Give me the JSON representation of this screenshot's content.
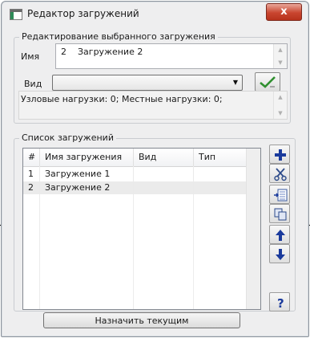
{
  "window": {
    "title": "Редактор загружений",
    "close_glyph": "x"
  },
  "edit_group": {
    "legend": "Редактирование выбранного загружения",
    "name_label": "Имя",
    "number": "2",
    "name_value": "Загружение 2",
    "kind_label": "Вид",
    "kind_value": "",
    "info_text": "Узловые нагрузки:  0;  Местные нагрузки:  0;"
  },
  "list_group": {
    "legend": "Список загружений",
    "columns": [
      "#",
      "Имя загружения",
      "Вид",
      "Тип"
    ],
    "rows": [
      {
        "num": "1",
        "name": "Загружение 1",
        "kind": "",
        "type": ""
      },
      {
        "num": "2",
        "name": "Загружение 2",
        "kind": "",
        "type": ""
      }
    ],
    "selected_row": 2
  },
  "side_buttons": [
    "add-icon",
    "cut-icon",
    "insert-icon",
    "copy-icon",
    "move-up-icon",
    "move-down-icon",
    "help-icon"
  ],
  "assign_button": "Назначить текущим",
  "colors": {
    "selection": "#ebebeb",
    "accent_add": "#1a3a9c",
    "accent_check": "#2f8f2f"
  }
}
